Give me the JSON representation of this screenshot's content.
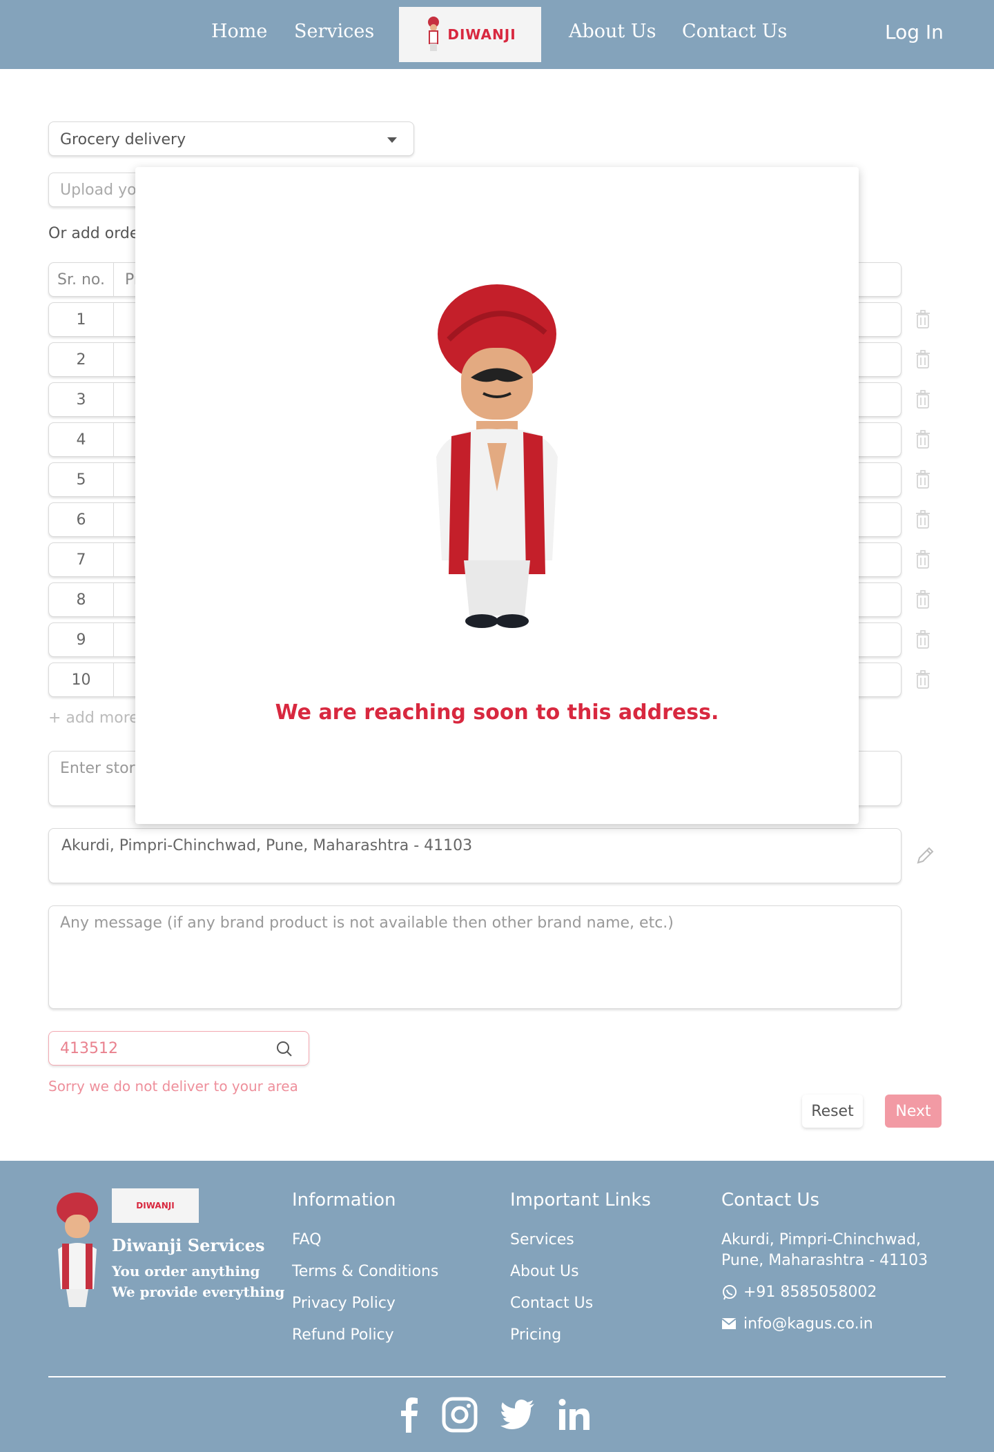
{
  "header": {
    "nav": [
      "Home",
      "Services",
      "About Us",
      "Contact Us"
    ],
    "logo_text": "DIWANJI",
    "login_label": "Log In"
  },
  "form": {
    "service_selected": "Grocery delivery",
    "upload_placeholder": "Upload you",
    "or_add_label": "Or add orde",
    "table_header": {
      "sr": "Sr. no.",
      "product": "Pr"
    },
    "rows": [
      "1",
      "2",
      "3",
      "4",
      "5",
      "6",
      "7",
      "8",
      "9",
      "10"
    ],
    "add_more_label": "+ add more",
    "store_placeholder": "Enter store",
    "address_value": "Akurdi, Pimpri-Chinchwad, Pune, Maharashtra - 41103",
    "message_placeholder": "Any message (if any brand product is not available then other brand name, etc.)",
    "pincode_value": "413512",
    "error_text": "Sorry we do not deliver to your area",
    "reset_label": "Reset",
    "next_label": "Next"
  },
  "modal": {
    "message": "We are reaching soon to this address."
  },
  "footer": {
    "brand": "Diwanji Services",
    "logo_text": "DIWANJI",
    "tagline_1": "You order anything",
    "tagline_2": "We provide everything",
    "info_heading": "Information",
    "info_links": [
      "FAQ",
      "Terms & Conditions",
      "Privacy Policy",
      "Refund Policy"
    ],
    "links_heading": "Important Links",
    "important_links": [
      "Services",
      "About Us",
      "Contact Us",
      "Pricing"
    ],
    "contact_heading": "Contact Us",
    "address_line_1": "Akurdi, Pimpri-Chinchwad,",
    "address_line_2": "Pune, Maharashtra - 41103",
    "phone": "+91 8585058002",
    "email": "info@kagus.co.in",
    "social_icons": [
      "facebook-icon",
      "instagram-icon",
      "twitter-icon",
      "linkedin-icon"
    ]
  },
  "colors": {
    "header_bg": "#84a3bb",
    "accent_red": "#d8283f",
    "next_button": "#f29aa4",
    "error_pink": "#ee8f9b"
  }
}
